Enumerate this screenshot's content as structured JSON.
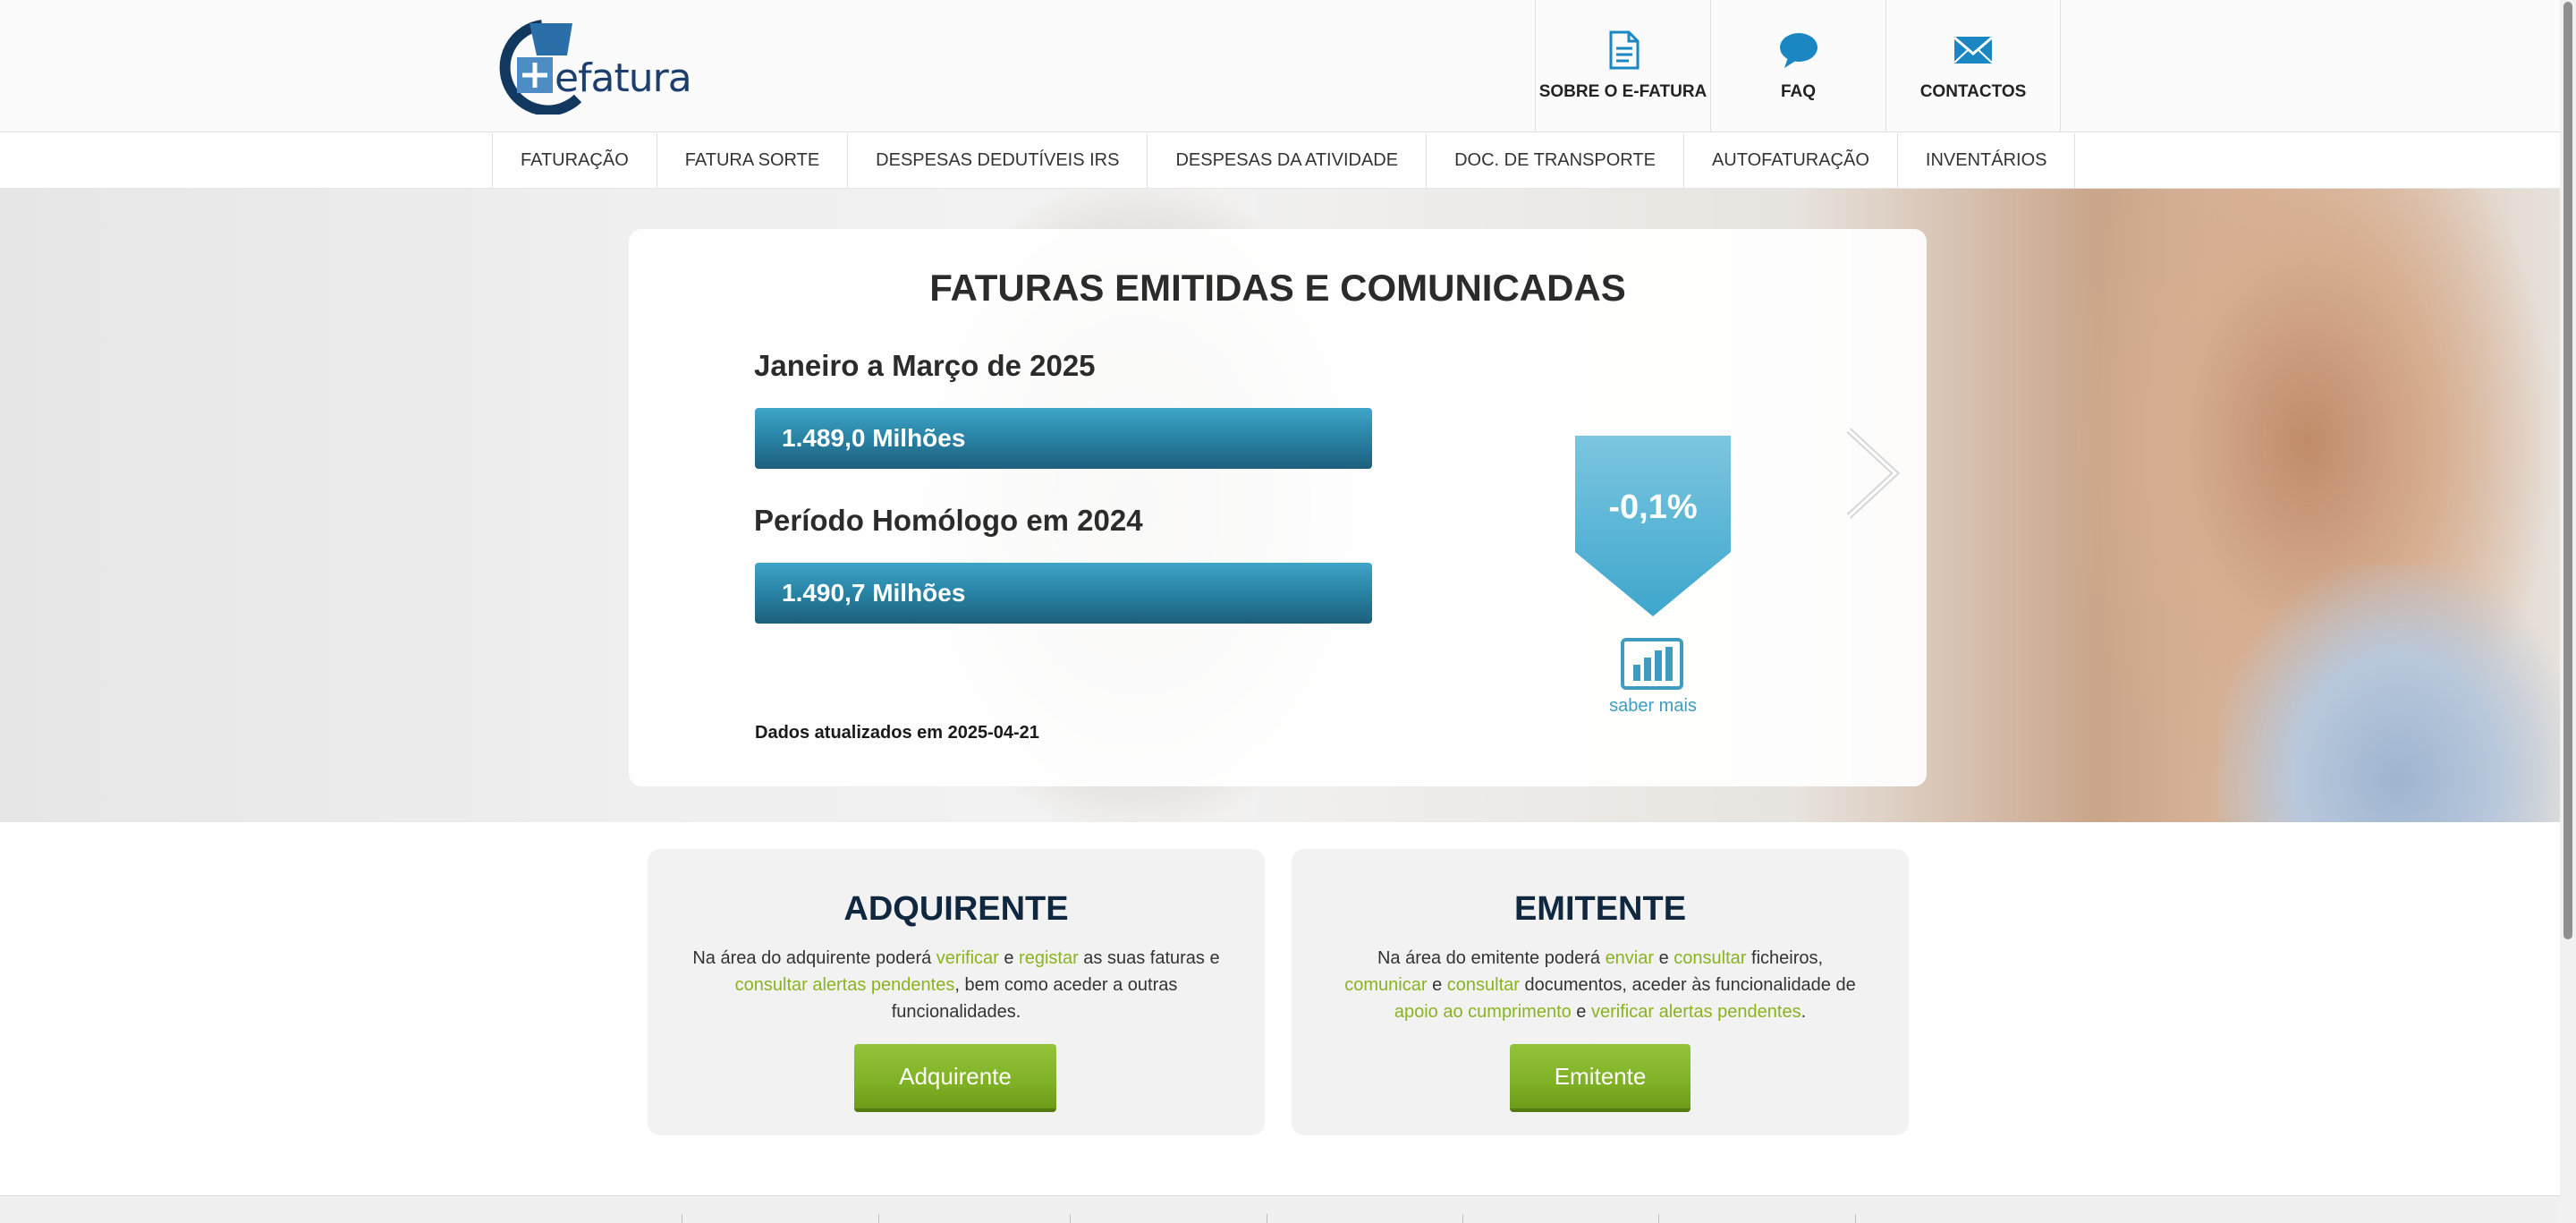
{
  "header": {
    "logo_text": "efatura",
    "top_links": [
      {
        "label": "SOBRE O E-FATURA",
        "icon": "document-icon"
      },
      {
        "label": "FAQ",
        "icon": "chat-bubble-icon"
      },
      {
        "label": "CONTACTOS",
        "icon": "envelope-icon"
      }
    ]
  },
  "nav": {
    "items": [
      "FATURAÇÃO",
      "FATURA SORTE",
      "DESPESAS DEDUTÍVEIS IRS",
      "DESPESAS DA ATIVIDADE",
      "DOC. DE TRANSPORTE",
      "AUTOFATURAÇÃO",
      "INVENTÁRIOS"
    ]
  },
  "hero": {
    "title": "FATURAS EMITIDAS E COMUNICADAS",
    "current_period_label": "Janeiro a Março de 2025",
    "current_value": "1.489,0 Milhões",
    "previous_period_label": "Período Homólogo em 2024",
    "previous_value": "1.490,7 Milhões",
    "variation": "-0,1%",
    "saber_mais": "saber mais",
    "updated": "Dados atualizados em 2025-04-21",
    "colors": {
      "bar": "#2a86a8",
      "badge": "#4fb0d2",
      "link": "#3e9cbf"
    }
  },
  "adquirente": {
    "title": "ADQUIRENTE",
    "t1": "Na área do adquirente poderá ",
    "l1": "verificar",
    "t2": " e ",
    "l2": "registar",
    "t3": " as suas faturas e ",
    "l3": "consultar alertas pendentes",
    "t4": ", bem como aceder a outras funcionalidades.",
    "button": "Adquirente"
  },
  "emitente": {
    "title": "EMITENTE",
    "t1": "Na área do emitente poderá ",
    "l1": "enviar",
    "t2": " e ",
    "l2": "consultar",
    "t3": " ficheiros, ",
    "l3": "comunicar",
    "t4": " e ",
    "l4": "consultar",
    "t5": " documentos, aceder às funcionalidade de ",
    "l5": "apoio ao cumprimento",
    "t6": " e ",
    "l6": "verificar alertas pendentes",
    "t7": ".",
    "button": "Emitente"
  },
  "accent_green": "#8ab321"
}
